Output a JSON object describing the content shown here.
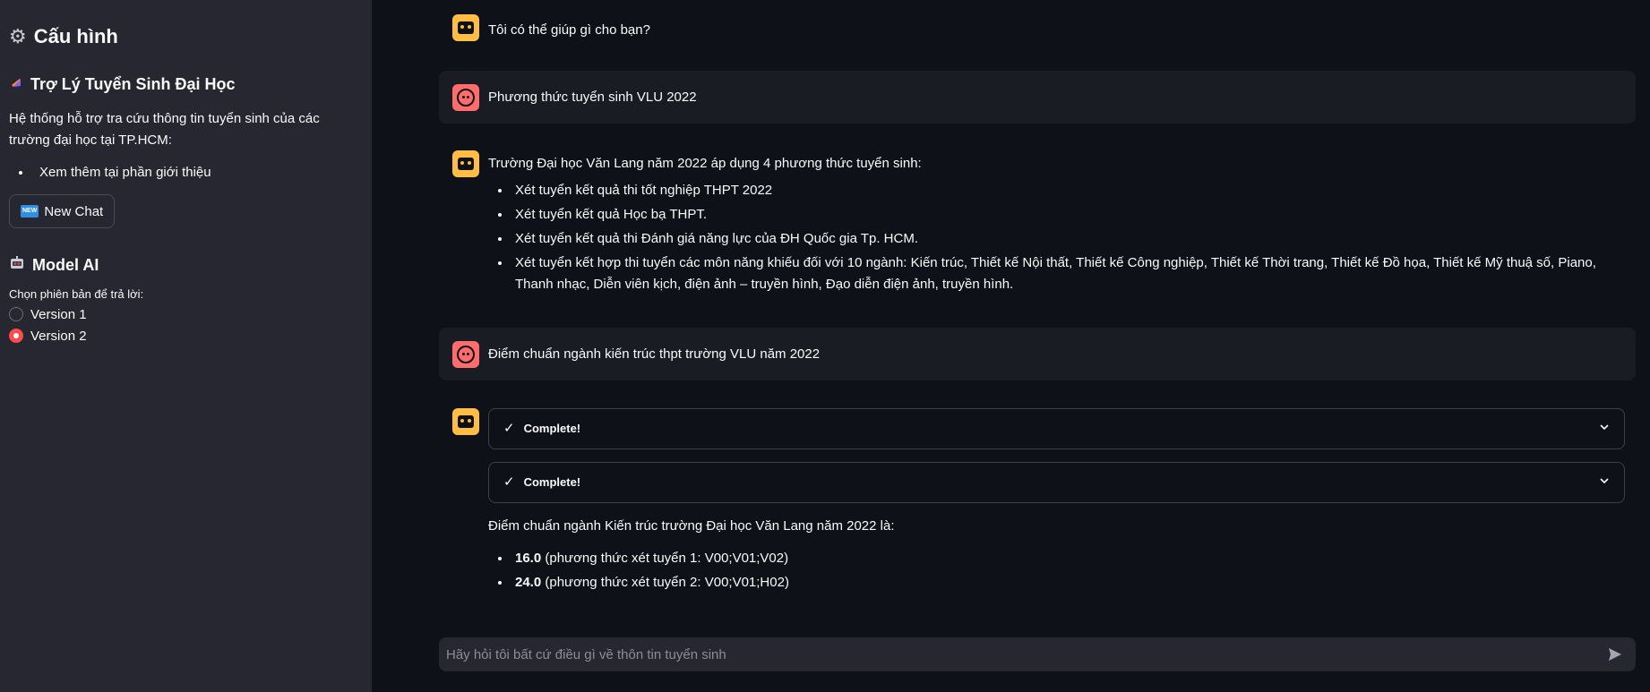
{
  "sidebar": {
    "title": "Cấu hình",
    "assistant_heading": "Trợ Lý Tuyển Sinh Đại Học",
    "description": "Hệ thống hỗ trợ tra cứu thông tin tuyển sinh của các trường đại học tại TP.HCM:",
    "list_items": [
      "Xem thêm tại phần giới thiệu"
    ],
    "new_chat_badge": "NEW",
    "new_chat_label": "New Chat",
    "model_heading": "Model AI",
    "radio_label": "Chọn phiên bản để trả lời:",
    "versions": [
      {
        "label": "Version 1",
        "selected": false
      },
      {
        "label": "Version 2",
        "selected": true
      }
    ]
  },
  "chat": {
    "messages": [
      {
        "role": "assistant",
        "text": "Tôi có thể giúp gì cho bạn?"
      },
      {
        "role": "user",
        "text": "Phương thức tuyển sinh VLU 2022"
      },
      {
        "role": "assistant",
        "text": "Trường Đại học Văn Lang năm 2022 áp dụng 4 phương thức tuyển sinh:",
        "items": [
          "Xét tuyển kết quả thi tốt nghiệp THPT 2022",
          "Xét tuyển kết quả Học bạ THPT.",
          "Xét tuyển kết quả thi Đánh giá năng lực của ĐH Quốc gia Tp. HCM.",
          "Xét tuyển kết hợp thi tuyển các môn năng khiếu đối với 10 ngành: Kiến trúc, Thiết kế Nội thất, Thiết kế Công nghiệp, Thiết kế Thời trang, Thiết kế Đồ họa, Thiết kế Mỹ thuậ số, Piano, Thanh nhạc, Diễn viên kịch, điện ảnh – truyền hình, Đạo diễn điện ảnh, truyền hình."
        ]
      },
      {
        "role": "user",
        "text": "Điểm chuẩn ngành kiến trúc thpt trường VLU năm 2022"
      },
      {
        "role": "assistant",
        "status_1": "Complete!",
        "status_2": "Complete!",
        "text": "Điểm chuẩn ngành Kiến trúc trường Đại học Văn Lang năm 2022 là:",
        "scores": [
          {
            "score": "16.0",
            "detail": " (phương thức xét tuyển 1: V00;V01;V02)"
          },
          {
            "score": "24.0",
            "detail": " (phương thức xét tuyển 2: V00;V01;H02)"
          }
        ]
      }
    ],
    "input_placeholder": "Hãy hỏi tôi bất cứ điều gì về thôn tin tuyển sinh"
  },
  "colors": {
    "sidebar_bg": "#262730",
    "main_bg": "#0e1117",
    "bot_avatar": "#ffbd45",
    "user_avatar": "#ff6c6c",
    "accent": "#ff4b4b"
  },
  "icons": {
    "title": "gear-icon",
    "assistant_heading": "graduation-cap-icon",
    "model_heading": "robot-icon",
    "send": "send-icon"
  }
}
